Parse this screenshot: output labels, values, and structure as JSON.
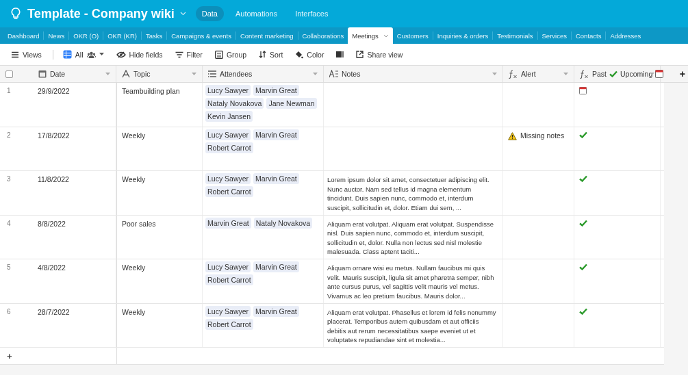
{
  "app": {
    "title": "Template - Company wiki",
    "nav": [
      {
        "label": "Data",
        "selected": true
      },
      {
        "label": "Automations",
        "selected": false
      },
      {
        "label": "Interfaces",
        "selected": false
      }
    ]
  },
  "tables": [
    {
      "label": "Dashboard",
      "selected": false
    },
    {
      "label": "News",
      "selected": false
    },
    {
      "label": "OKR (O)",
      "selected": false
    },
    {
      "label": "OKR (KR)",
      "selected": false
    },
    {
      "label": "Tasks",
      "selected": false
    },
    {
      "label": "Campaigns & events",
      "selected": false
    },
    {
      "label": "Content marketing",
      "selected": false
    },
    {
      "label": "Collaborations",
      "selected": false
    },
    {
      "label": "Meetings",
      "selected": true
    },
    {
      "label": "Customers",
      "selected": false
    },
    {
      "label": "Inquiries & orders",
      "selected": false
    },
    {
      "label": "Testimonials",
      "selected": false
    },
    {
      "label": "Services",
      "selected": false
    },
    {
      "label": "Contacts",
      "selected": false
    },
    {
      "label": "Addresses",
      "selected": false
    }
  ],
  "toolbar": [
    {
      "kind": "views",
      "label": "Views"
    },
    {
      "kind": "view",
      "label": "All"
    },
    {
      "kind": "hide",
      "label": "Hide fields"
    },
    {
      "kind": "filter",
      "label": "Filter"
    },
    {
      "kind": "group",
      "label": "Group"
    },
    {
      "kind": "sort",
      "label": "Sort"
    },
    {
      "kind": "color",
      "label": "Color"
    },
    {
      "kind": "height"
    },
    {
      "kind": "share",
      "label": "Share view"
    }
  ],
  "select_all": {
    "checked": false
  },
  "columns": [
    {
      "kind": "date",
      "label": "Date"
    },
    {
      "kind": "text",
      "label": "Topic"
    },
    {
      "kind": "multi",
      "label": "Attendees"
    },
    {
      "kind": "long",
      "label": "Notes"
    },
    {
      "kind": "formula",
      "label": "Alert"
    },
    {
      "kind": "status",
      "label_parts": [
        "Past",
        "Upcoming"
      ]
    }
  ],
  "rows": [
    {
      "number": "1",
      "date": "29/9/2022",
      "topic": "Teambuilding plan",
      "attendees": [
        "Lucy Sawyer",
        "Marvin Great",
        "Nataly Novakova",
        "Jane Newman",
        "Kevin Jansen"
      ],
      "upcoming": true
    },
    {
      "number": "2",
      "date": "17/8/2022",
      "topic": "Weekly",
      "attendees": [
        "Lucy Sawyer",
        "Marvin Great",
        "Robert Carrot"
      ],
      "alert": "Missing notes",
      "upcoming": false
    },
    {
      "number": "3",
      "date": "11/8/2022",
      "topic": "Weekly",
      "attendees": [
        "Lucy Sawyer",
        "Marvin Great",
        "Robert Carrot"
      ],
      "notes": "Lorem ipsum dolor sit amet, consectetuer adipiscing elit. Nunc auctor. Nam sed tellus id magna elementum tincidunt. Duis sapien nunc, commodo et, interdum suscipit, sollicitudin et, dolor. Etiam dui sem, ...",
      "upcoming": false
    },
    {
      "number": "4",
      "date": "8/8/2022",
      "topic": "Poor sales",
      "attendees": [
        "Marvin Great",
        "Nataly Novakova"
      ],
      "notes": "Aliquam erat volutpat. Aliquam erat volutpat. Suspendisse nisl. Duis sapien nunc, commodo et, interdum suscipit, sollicitudin et, dolor. Nulla non lectus sed nisl molestie malesuada. Class aptent taciti...",
      "upcoming": false
    },
    {
      "number": "5",
      "date": "4/8/2022",
      "topic": "Weekly",
      "attendees": [
        "Lucy Sawyer",
        "Marvin Great",
        "Robert Carrot"
      ],
      "notes": "Aliquam ornare wisi eu metus. Nullam faucibus mi quis velit. Mauris suscipit, ligula sit amet pharetra semper, nibh ante cursus purus, vel sagittis velit mauris vel metus. Vivamus ac leo pretium faucibus. Mauris dolor...",
      "upcoming": false
    },
    {
      "number": "6",
      "date": "28/7/2022",
      "topic": "Weekly",
      "attendees": [
        "Lucy Sawyer",
        "Marvin Great",
        "Robert Carrot"
      ],
      "notes": "Aliquam erat volutpat. Phasellus et lorem id felis nonummy placerat. Temporibus autem quibusdam et aut officiis debitis aut rerum necessitatibus saepe eveniet ut et voluptates repudiandae sint et molestia...",
      "upcoming": false
    }
  ],
  "add_row": "+",
  "add_column": "+"
}
